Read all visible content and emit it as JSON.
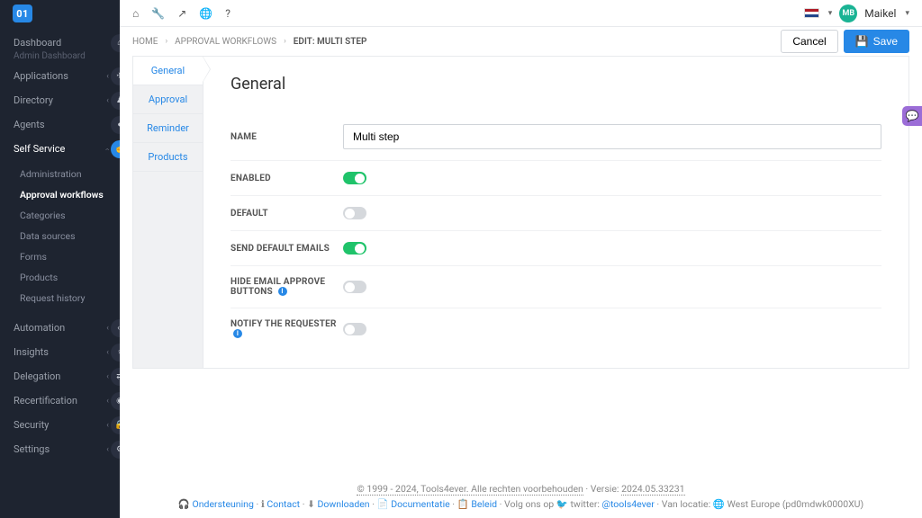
{
  "logo": "01",
  "sidebar": {
    "dashboard": {
      "label": "Dashboard",
      "sub": "Admin Dashboard"
    },
    "applications": "Applications",
    "directory": "Directory",
    "agents": "Agents",
    "selfservice": "Self Service",
    "automation": "Automation",
    "insights": "Insights",
    "delegation": "Delegation",
    "recertification": "Recertification",
    "security": "Security",
    "settings": "Settings",
    "sub": {
      "administration": "Administration",
      "approval_workflows": "Approval workflows",
      "categories": "Categories",
      "data_sources": "Data sources",
      "forms": "Forms",
      "products": "Products",
      "request_history": "Request history"
    }
  },
  "topbar": {
    "username": "Maikel",
    "avatar_initials": "MB"
  },
  "breadcrumbs": {
    "home": "HOME",
    "l1": "APPROVAL WORKFLOWS",
    "l2": "EDIT: MULTI STEP"
  },
  "actions": {
    "cancel": "Cancel",
    "save": "Save"
  },
  "tabs": {
    "general": "General",
    "approval": "Approval",
    "reminder": "Reminder",
    "products": "Products"
  },
  "form": {
    "title": "General",
    "name_label": "Name",
    "name_value": "Multi step",
    "enabled_label": "Enabled",
    "enabled": true,
    "default_label": "Default",
    "default": false,
    "send_default_emails_label": "Send default emails",
    "send_default_emails": true,
    "hide_email_approve_buttons_label": "Hide email approve buttons",
    "hide_email_approve_buttons": false,
    "notify_requester_label": "Notify the requester",
    "notify_requester": false
  },
  "footer": {
    "copyright": "© 1999 - 2024, Tools4ever. Alle rechten voorbehouden",
    "version_label": "Versie:",
    "version": "2024.05.33231",
    "ondersteuning": "Ondersteuning",
    "contact": "Contact",
    "downloaden": "Downloaden",
    "documentatie": "Documentatie",
    "beleid": "Beleid",
    "volg": "Volg ons op",
    "twitter_label": "twitter:",
    "twitter_handle": "@tools4ever",
    "location_label": "Van locatie:",
    "location": "West Europe (pd0mdwk0000XU)"
  }
}
